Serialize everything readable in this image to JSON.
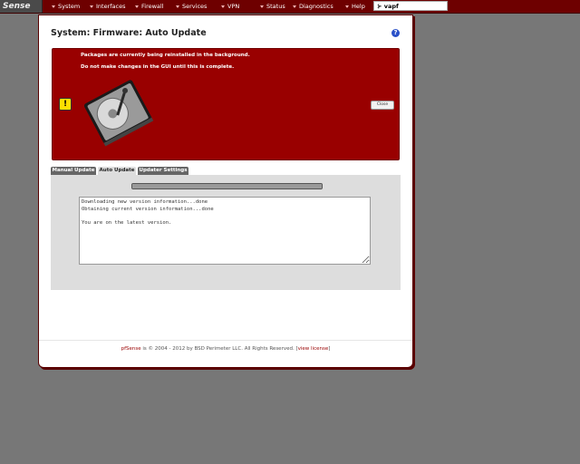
{
  "topbar": {
    "logo_text": "Sense",
    "nav_items": [
      "System",
      "Interfaces",
      "Firewall",
      "Services",
      "VPN",
      "Status",
      "Diagnostics",
      "Help"
    ],
    "host_label": "vapf"
  },
  "page": {
    "title": "System: Firmware: Auto Update",
    "help_icon": "?"
  },
  "alert": {
    "line1": "Packages are currently being reinstalled in the background.",
    "line2": "Do not make changes in the GUI until this is complete.",
    "close_label": "Close",
    "warn_icon": "!"
  },
  "tabs": [
    {
      "label": "Manual Update",
      "active": false
    },
    {
      "label": "Auto Update",
      "active": true
    },
    {
      "label": "Updater Settings",
      "active": false
    }
  ],
  "update": {
    "progress": 1.0,
    "console_text": "Downloading new version information...done\nObtaining current version information...done\n\nYou are on the latest version."
  },
  "footer": {
    "brand": "pfSense",
    "text": " is © 2004 - 2012 by BSD Perimeter LLC. All Rights Reserved. [",
    "link": "view license",
    "close": "]"
  },
  "colors": {
    "nav": "#6e0000",
    "alert_bg": "#990000",
    "desktop": "#777777"
  }
}
